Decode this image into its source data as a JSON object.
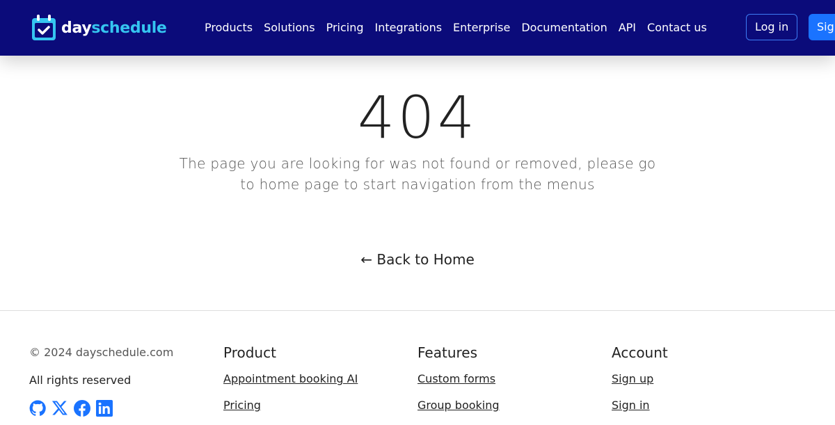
{
  "header": {
    "logo": {
      "part1": "day",
      "part2": "schedule"
    },
    "menu": [
      "Products",
      "Solutions",
      "Pricing",
      "Integrations",
      "Enterprise",
      "Documentation",
      "API",
      "Contact us"
    ],
    "login": "Log in",
    "signup": "Sign up"
  },
  "main": {
    "code": "404",
    "message": "The page you are looking for was not found or removed, please go to home page to start navigation from the menus",
    "back": "← Back to Home"
  },
  "footer": {
    "copyright": "© 2024 dayschedule.com",
    "rights": "All rights reserved",
    "social": [
      "github-icon",
      "x-icon",
      "facebook-icon",
      "linkedin-icon"
    ],
    "columns": [
      {
        "title": "Product",
        "links": [
          "Appointment booking AI",
          "Pricing"
        ]
      },
      {
        "title": "Features",
        "links": [
          "Custom forms",
          "Group booking"
        ]
      },
      {
        "title": "Account",
        "links": [
          "Sign up",
          "Sign in"
        ]
      }
    ]
  },
  "colors": {
    "nav": "#0b0b7a",
    "accent": "#1a73ff",
    "logo_accent": "#35c5f0"
  }
}
